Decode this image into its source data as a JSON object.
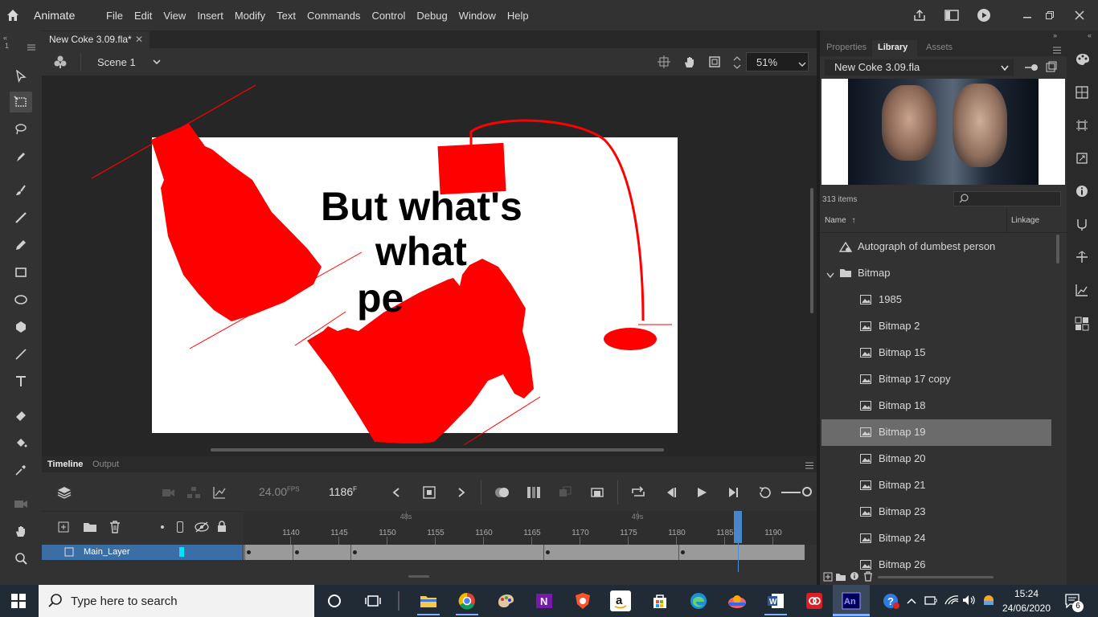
{
  "app": {
    "name": "Animate",
    "menus": [
      "File",
      "Edit",
      "View",
      "Insert",
      "Modify",
      "Text",
      "Commands",
      "Control",
      "Debug",
      "Window",
      "Help"
    ]
  },
  "document": {
    "tab_title": "New Coke 3.09.fla*",
    "scene": "Scene 1",
    "zoom": "51%"
  },
  "stage": {
    "text_lines": [
      "But what's",
      "what",
      "pe"
    ]
  },
  "right_panel": {
    "tabs": [
      "Properties",
      "Library",
      "Assets"
    ],
    "active_tab": "Library",
    "library_file": "New Coke 3.09.fla",
    "item_count": "313 items",
    "search_placeholder": "",
    "columns": {
      "name": "Name",
      "linkage": "Linkage"
    },
    "items": [
      {
        "label": "Autograph of dumbest person",
        "type": "graphic",
        "indent": 0
      },
      {
        "label": "Bitmap",
        "type": "folder",
        "indent": 0
      },
      {
        "label": "1985",
        "type": "bitmap",
        "indent": 1
      },
      {
        "label": "Bitmap 2",
        "type": "bitmap",
        "indent": 1
      },
      {
        "label": "Bitmap 15",
        "type": "bitmap",
        "indent": 1
      },
      {
        "label": "Bitmap 17 copy",
        "type": "bitmap",
        "indent": 1
      },
      {
        "label": "Bitmap 18",
        "type": "bitmap",
        "indent": 1
      },
      {
        "label": "Bitmap 19",
        "type": "bitmap",
        "indent": 1,
        "selected": true
      },
      {
        "label": "Bitmap 20",
        "type": "bitmap",
        "indent": 1
      },
      {
        "label": "Bitmap 21",
        "type": "bitmap",
        "indent": 1
      },
      {
        "label": "Bitmap 23",
        "type": "bitmap",
        "indent": 1
      },
      {
        "label": "Bitmap 24",
        "type": "bitmap",
        "indent": 1
      },
      {
        "label": "Bitmap 26",
        "type": "bitmap",
        "indent": 1
      }
    ]
  },
  "timeline": {
    "tabs": [
      "Timeline",
      "Output"
    ],
    "fps_value": "24.00",
    "fps_unit": "FPS",
    "frame_value": "1186",
    "frame_unit": "F",
    "seconds_marks": [
      "48s",
      "49s"
    ],
    "frame_numbers": [
      "1140",
      "1145",
      "1150",
      "1155",
      "1160",
      "1165",
      "1170",
      "1175",
      "1180",
      "1185",
      "1190"
    ],
    "current_frame": 1186,
    "layer_name": "Main_Layer"
  },
  "taskbar": {
    "search_placeholder": "Type here to search",
    "time": "15:24",
    "date": "24/06/2020",
    "notification_count": "6"
  },
  "colors": {
    "accent_red": "#ff0000",
    "selection_blue": "#3a6ea5",
    "playhead": "#4a90d9"
  }
}
